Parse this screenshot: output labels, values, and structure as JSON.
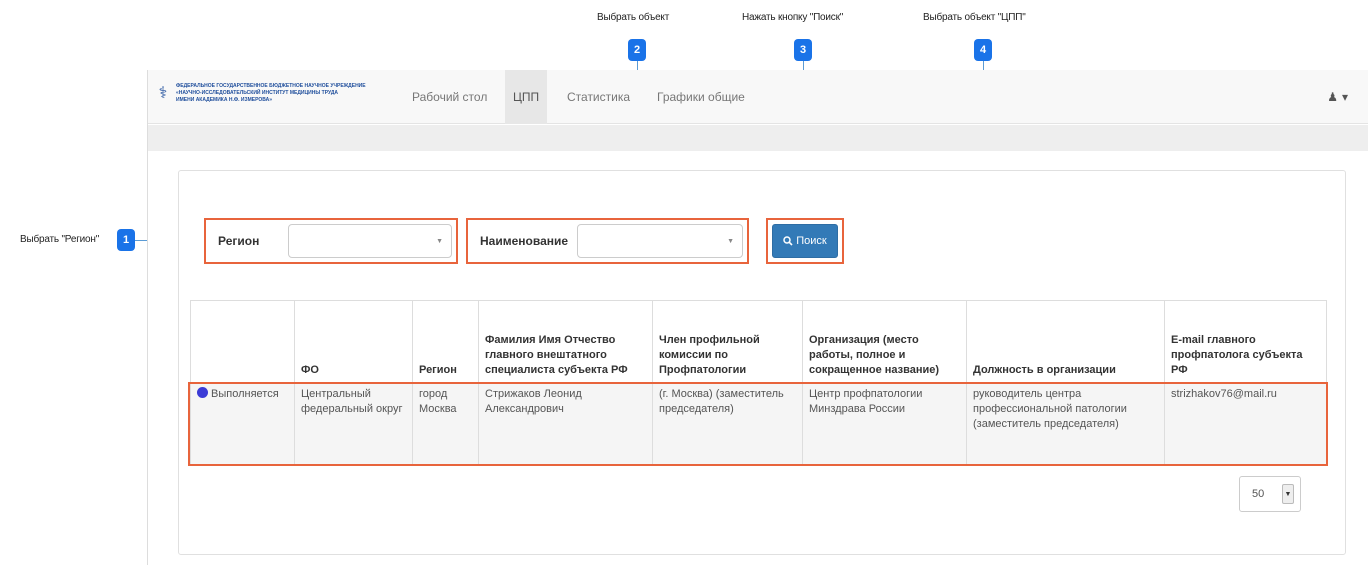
{
  "callouts": [
    {
      "number": "1",
      "text": "Выбрать \"Регион\""
    },
    {
      "number": "2",
      "text": "Выбрать объект"
    },
    {
      "number": "3",
      "text": "Нажать кнопку \"Поиск\""
    },
    {
      "number": "4",
      "text": "Выбрать объект \"ЦПП\""
    }
  ],
  "navbar": {
    "logo_lines": [
      "ФЕДЕРАЛЬНОЕ ГОСУДАРСТВЕННОЕ БЮДЖЕТНОЕ НАУЧНОЕ УЧРЕЖДЕНИЕ",
      "«НАУЧНО-ИССЛЕДОВАТЕЛЬСКИЙ ИНСТИТУТ МЕДИЦИНЫ ТРУДА",
      "ИМЕНИ АКАДЕМИКА Н.Ф. ИЗМЕРОВА»"
    ],
    "items": [
      {
        "label": "Рабочий стол"
      },
      {
        "label": "ЦПП"
      },
      {
        "label": "Статистика"
      },
      {
        "label": "Графики общие"
      }
    ],
    "user_icon": "user-icon",
    "user_caret": "▾"
  },
  "filters": {
    "region_label": "Регион",
    "region_value": "",
    "name_label": "Наименование",
    "name_value": "",
    "search_label": "Поиск",
    "search_icon": "search-icon"
  },
  "table": {
    "headers": [
      "",
      "ФО",
      "Регион",
      "Фамилия Имя Отчество главного внештатного специалиста субъекта РФ",
      "Член профильной комиссии по Профпатологии",
      "Организация (место работы, полное и сокращенное название)",
      "Должность в организации",
      "E-mail главного профпатолога субъекта РФ"
    ],
    "rows": [
      {
        "status": "Выполняется",
        "status_color": "#3b3bd6",
        "fo": "Центральный федеральный округ",
        "region": "город Москва",
        "fio": "Стрижаков Леонид Александрович",
        "commission": "(г. Москва) (заместитель председателя)",
        "organization": "Центр профпатологии Минздрава России",
        "position": "руководитель центра профессиональной патологии (заместитель председателя)",
        "email": "strizhakov76@mail.ru"
      }
    ]
  },
  "pager": {
    "page_size": "50"
  },
  "colors": {
    "highlight": "#e8643c",
    "marker": "#1a73e8",
    "primary_button": "#337ab7"
  }
}
